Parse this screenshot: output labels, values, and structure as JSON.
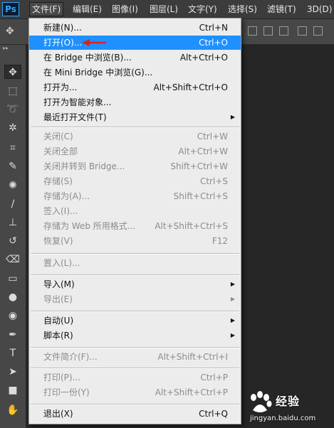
{
  "app": {
    "logo": "Ps"
  },
  "menubar": [
    {
      "label": "文件(F)",
      "active": true
    },
    {
      "label": "编辑(E)"
    },
    {
      "label": "图像(I)"
    },
    {
      "label": "图层(L)"
    },
    {
      "label": "文字(Y)"
    },
    {
      "label": "选择(S)"
    },
    {
      "label": "滤镜(T)"
    },
    {
      "label": "3D(D)"
    }
  ],
  "file_menu": [
    {
      "label": "新建(N)...",
      "shortcut": "Ctrl+N"
    },
    {
      "label": "打开(O)...",
      "shortcut": "Ctrl+O",
      "highlighted": true
    },
    {
      "label": "在 Bridge 中浏览(B)...",
      "shortcut": "Alt+Ctrl+O"
    },
    {
      "label": "在 Mini Bridge 中浏览(G)...",
      "shortcut": ""
    },
    {
      "label": "打开为...",
      "shortcut": "Alt+Shift+Ctrl+O"
    },
    {
      "label": "打开为智能对象...",
      "shortcut": ""
    },
    {
      "label": "最近打开文件(T)",
      "shortcut": "",
      "submenu": true
    },
    {
      "label": "关闭(C)",
      "shortcut": "Ctrl+W",
      "disabled": true
    },
    {
      "label": "关闭全部",
      "shortcut": "Alt+Ctrl+W",
      "disabled": true
    },
    {
      "label": "关闭并转到 Bridge...",
      "shortcut": "Shift+Ctrl+W",
      "disabled": true
    },
    {
      "label": "存储(S)",
      "shortcut": "Ctrl+S",
      "disabled": true
    },
    {
      "label": "存储为(A)...",
      "shortcut": "Shift+Ctrl+S",
      "disabled": true
    },
    {
      "label": "签入(I)...",
      "shortcut": "",
      "disabled": true
    },
    {
      "label": "存储为 Web 所用格式...",
      "shortcut": "Alt+Shift+Ctrl+S",
      "disabled": true
    },
    {
      "label": "恢复(V)",
      "shortcut": "F12",
      "disabled": true
    },
    {
      "label": "置入(L)...",
      "shortcut": "",
      "disabled": true
    },
    {
      "label": "导入(M)",
      "shortcut": "",
      "submenu": true
    },
    {
      "label": "导出(E)",
      "shortcut": "",
      "submenu": true,
      "disabled": true
    },
    {
      "label": "自动(U)",
      "shortcut": "",
      "submenu": true
    },
    {
      "label": "脚本(R)",
      "shortcut": "",
      "submenu": true
    },
    {
      "label": "文件简介(F)...",
      "shortcut": "Alt+Shift+Ctrl+I",
      "disabled": true
    },
    {
      "label": "打印(P)...",
      "shortcut": "Ctrl+P",
      "disabled": true
    },
    {
      "label": "打印一份(Y)",
      "shortcut": "Alt+Shift+Ctrl+P",
      "disabled": true
    },
    {
      "label": "退出(X)",
      "shortcut": "Ctrl+Q"
    }
  ],
  "tools": [
    {
      "icon": "move-tool-icon",
      "glyph": "✥",
      "selected": true
    },
    {
      "icon": "marquee-tool-icon",
      "glyph": "⬚"
    },
    {
      "icon": "lasso-tool-icon",
      "glyph": "➰"
    },
    {
      "icon": "magic-wand-tool-icon",
      "glyph": "✲"
    },
    {
      "icon": "crop-tool-icon",
      "glyph": "⌗"
    },
    {
      "icon": "eyedropper-tool-icon",
      "glyph": "✎"
    },
    {
      "icon": "healing-brush-tool-icon",
      "glyph": "✺"
    },
    {
      "icon": "brush-tool-icon",
      "glyph": "∕"
    },
    {
      "icon": "clone-stamp-tool-icon",
      "glyph": "⊥"
    },
    {
      "icon": "history-brush-tool-icon",
      "glyph": "↺"
    },
    {
      "icon": "eraser-tool-icon",
      "glyph": "⌫"
    },
    {
      "icon": "gradient-tool-icon",
      "glyph": "▭"
    },
    {
      "icon": "blur-tool-icon",
      "glyph": "●"
    },
    {
      "icon": "dodge-tool-icon",
      "glyph": "◉"
    },
    {
      "icon": "pen-tool-icon",
      "glyph": "✒"
    },
    {
      "icon": "type-tool-icon",
      "glyph": "T"
    },
    {
      "icon": "path-selection-tool-icon",
      "glyph": "➤"
    },
    {
      "icon": "rectangle-tool-icon",
      "glyph": "■"
    },
    {
      "icon": "hand-tool-icon",
      "glyph": "✋"
    }
  ],
  "watermark": {
    "brand": "经验",
    "url": "jingyan.baidu.com"
  },
  "colors": {
    "highlight": "#1e90ff",
    "annotation_arrow": "#e0201c"
  }
}
